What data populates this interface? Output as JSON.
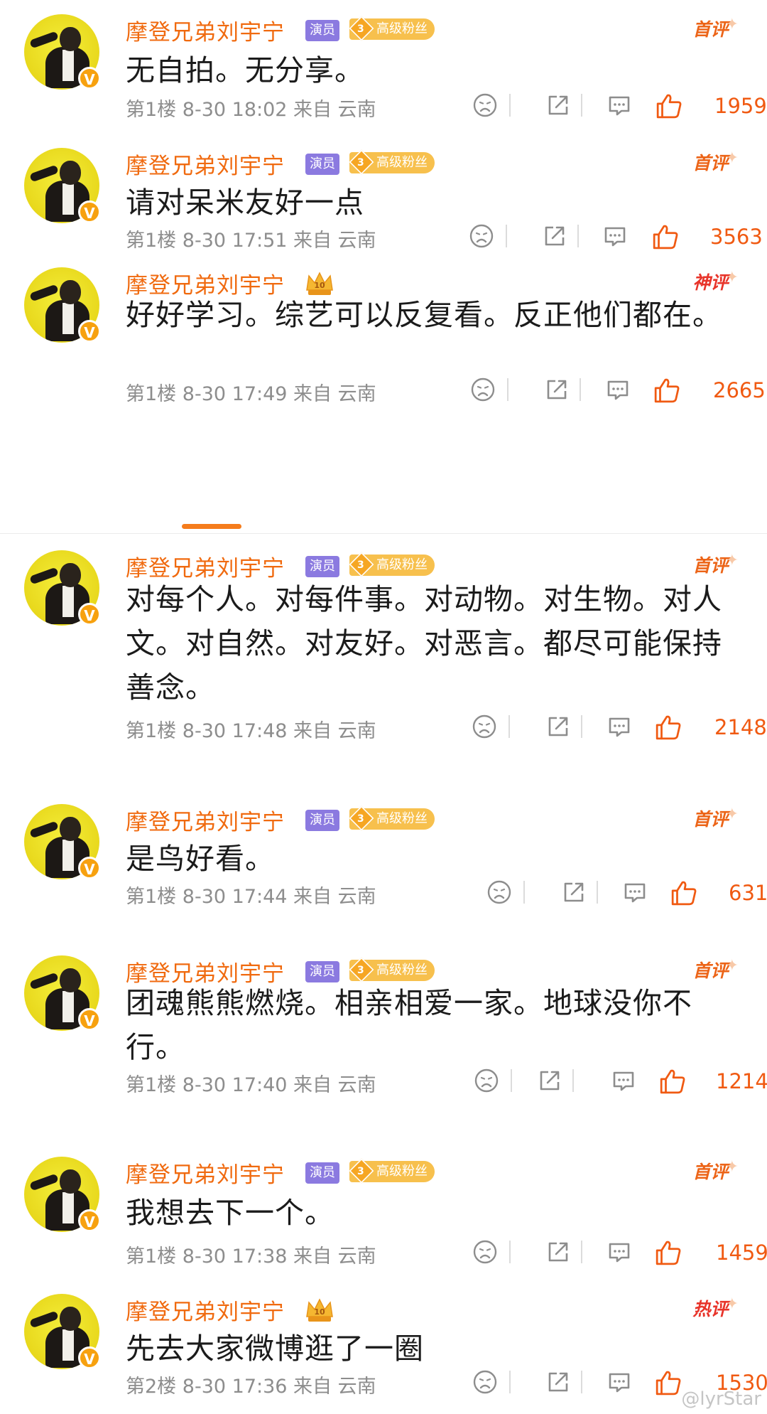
{
  "user": {
    "name": "摩登兄弟刘宇宁",
    "verified_badge": "V",
    "actor_tag": "演员",
    "fan_level": "3",
    "fan_tag": "高级粉丝",
    "crown_level": "10"
  },
  "comments": [
    {
      "text": "无自拍。无分享。",
      "floor": "第1楼",
      "time": "8-30 18:02",
      "source": "来自 云南",
      "likes": "1959",
      "ribbon": "首评",
      "ribbon_color": "#ec6417",
      "badges": "tags"
    },
    {
      "text": "请对呆米友好一点",
      "floor": "第1楼",
      "time": "8-30 17:51",
      "source": "来自 云南",
      "likes": "3563",
      "ribbon": "首评",
      "ribbon_color": "#ec6417",
      "badges": "tags"
    },
    {
      "text": "好好学习。综艺可以反复看。反正他们都在。",
      "floor": "第1楼",
      "time": "8-30 17:49",
      "source": "来自 云南",
      "likes": "2665",
      "ribbon": "神评",
      "ribbon_color": "#e8342a",
      "badges": "crown"
    },
    {
      "text": "对每个人。对每件事。对动物。对生物。对人文。对自然。对友好。对恶言。都尽可能保持善念。",
      "floor": "第1楼",
      "time": "8-30 17:48",
      "source": "来自 云南",
      "likes": "2148",
      "ribbon": "首评",
      "ribbon_color": "#ec6417",
      "badges": "tags"
    },
    {
      "text": "是鸟好看。",
      "floor": "第1楼",
      "time": "8-30 17:44",
      "source": "来自 云南",
      "likes": "631",
      "ribbon": "首评",
      "ribbon_color": "#ec6417",
      "badges": "tags"
    },
    {
      "text": "团魂熊熊燃烧。相亲相爱一家。地球没你不行。",
      "floor": "第1楼",
      "time": "8-30 17:40",
      "source": "来自 云南",
      "likes": "1214",
      "ribbon": "首评",
      "ribbon_color": "#ec6417",
      "badges": "tags"
    },
    {
      "text": "我想去下一个。",
      "floor": "第1楼",
      "time": "8-30 17:38",
      "source": "来自 云南",
      "likes": "1459",
      "ribbon": "首评",
      "ribbon_color": "#ec6417",
      "badges": "tags"
    },
    {
      "text": "先去大家微博逛了一圈",
      "floor": "第2楼",
      "time": "8-30 17:36",
      "source": "来自 云南",
      "likes": "1530",
      "ribbon": "热评",
      "ribbon_color": "#e8342a",
      "badges": "crown"
    }
  ],
  "icons": [
    "dislike-icon",
    "share-icon",
    "comment-icon",
    "like-icon"
  ],
  "colors": {
    "accent": "#f06a0f",
    "like": "#f05a12",
    "meta": "#8d8d8d",
    "text": "#1b1b1b"
  },
  "watermark": "@lyrStar"
}
